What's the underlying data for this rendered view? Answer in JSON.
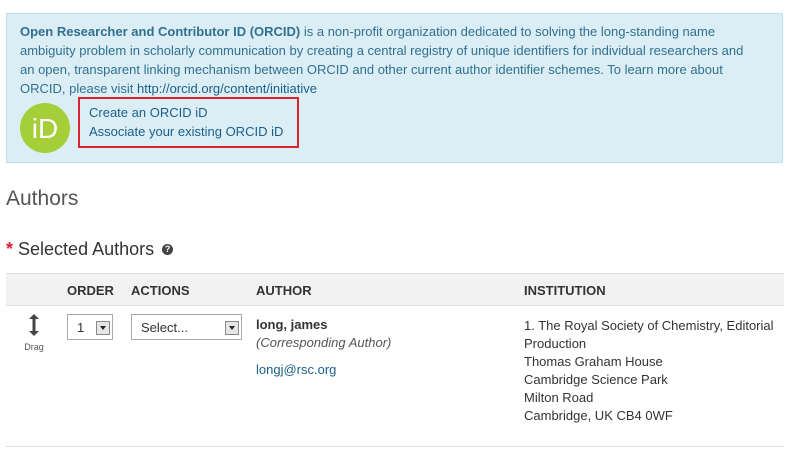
{
  "orcid": {
    "intro_bold": "Open Researcher and Contributor ID (ORCID)",
    "intro_text": " is a non-profit organization dedicated to solving the long-standing name ambiguity problem in scholarly communication by creating a central registry of unique identifiers for individual researchers and an open, transparent linking mechanism between ORCID and other current author identifier schemes. To learn more about ORCID, please visit ",
    "intro_link": "http://orcid.org/content/initiative",
    "logo_text": "iD",
    "create_link": "Create an ORCID iD",
    "associate_link": "Associate your existing ORCID iD"
  },
  "headings": {
    "authors": "Authors",
    "required_marker": "*",
    "selected_authors": "Selected Authors",
    "help_icon_glyph": "?"
  },
  "table": {
    "columns": {
      "order": "ORDER",
      "actions": "ACTIONS",
      "author": "AUTHOR",
      "institution": "INSTITUTION"
    },
    "rows": [
      {
        "drag_label": "Drag",
        "order_value": "1",
        "actions_value": "Select...",
        "author_name": "long, james",
        "author_role": "(Corresponding Author)",
        "author_email": "longj@rsc.org",
        "institution_lines": [
          "1. The Royal Society of Chemistry, Editorial Production",
          "Thomas Graham House",
          "Cambridge Science Park",
          "Milton Road",
          "Cambridge, UK CB4 0WF"
        ]
      }
    ]
  },
  "colors": {
    "info_background": "#dbeef6",
    "info_text": "#31708f",
    "link": "#1a5f8a",
    "orcid_green": "#a6ce39",
    "highlight_border": "#d9242f"
  },
  "icons": {
    "drag": "drag-arrows-icon",
    "help": "question-circle-icon",
    "dropdown": "chevron-down-icon"
  }
}
